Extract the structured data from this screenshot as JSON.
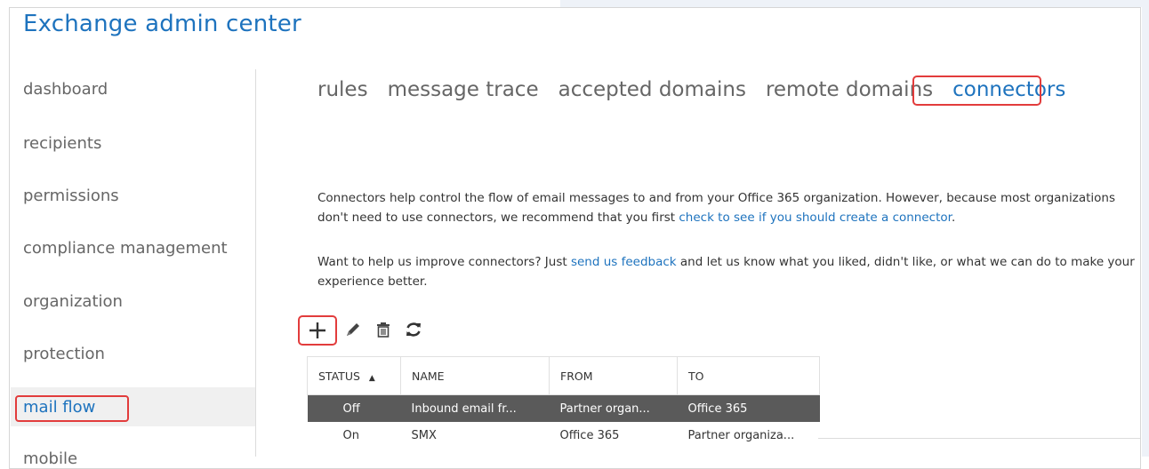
{
  "app": {
    "title": "Exchange admin center"
  },
  "sidebar": {
    "items": [
      {
        "label": "dashboard"
      },
      {
        "label": "recipients"
      },
      {
        "label": "permissions"
      },
      {
        "label": "compliance management"
      },
      {
        "label": "organization"
      },
      {
        "label": "protection"
      },
      {
        "label": "mail flow",
        "active": true
      },
      {
        "label": "mobile"
      }
    ]
  },
  "tabs": [
    {
      "label": "rules"
    },
    {
      "label": "message trace"
    },
    {
      "label": "accepted domains"
    },
    {
      "label": "remote domains"
    },
    {
      "label": "connectors",
      "active": true
    }
  ],
  "intro": {
    "p1_text": "Connectors help control the flow of email messages to and from your Office 365 organization. However, because most organizations don't need to use connectors, we recommend that you first ",
    "p1_link": "check to see if you should create a connector",
    "p1_end": ".",
    "p2_text": "Want to help us improve connectors? Just ",
    "p2_link": "send us feedback",
    "p2_end": " and let us know what you liked, didn't like, or what we can do to make your experience better."
  },
  "toolbar": {
    "icons": [
      "add-icon",
      "edit-icon",
      "delete-icon",
      "refresh-icon"
    ]
  },
  "table": {
    "columns": [
      "STATUS",
      "NAME",
      "FROM",
      "TO"
    ],
    "rows": [
      {
        "status": "Off",
        "name": "Inbound email fr...",
        "from": "Partner organ...",
        "to": "Office 365"
      },
      {
        "status": "On",
        "name": "SMX",
        "from": "Office 365",
        "to": "Partner organiza..."
      }
    ]
  },
  "colors": {
    "accent": "#1e73be",
    "highlight": "#e23c3c",
    "selected_row": "#5a5a5a"
  }
}
